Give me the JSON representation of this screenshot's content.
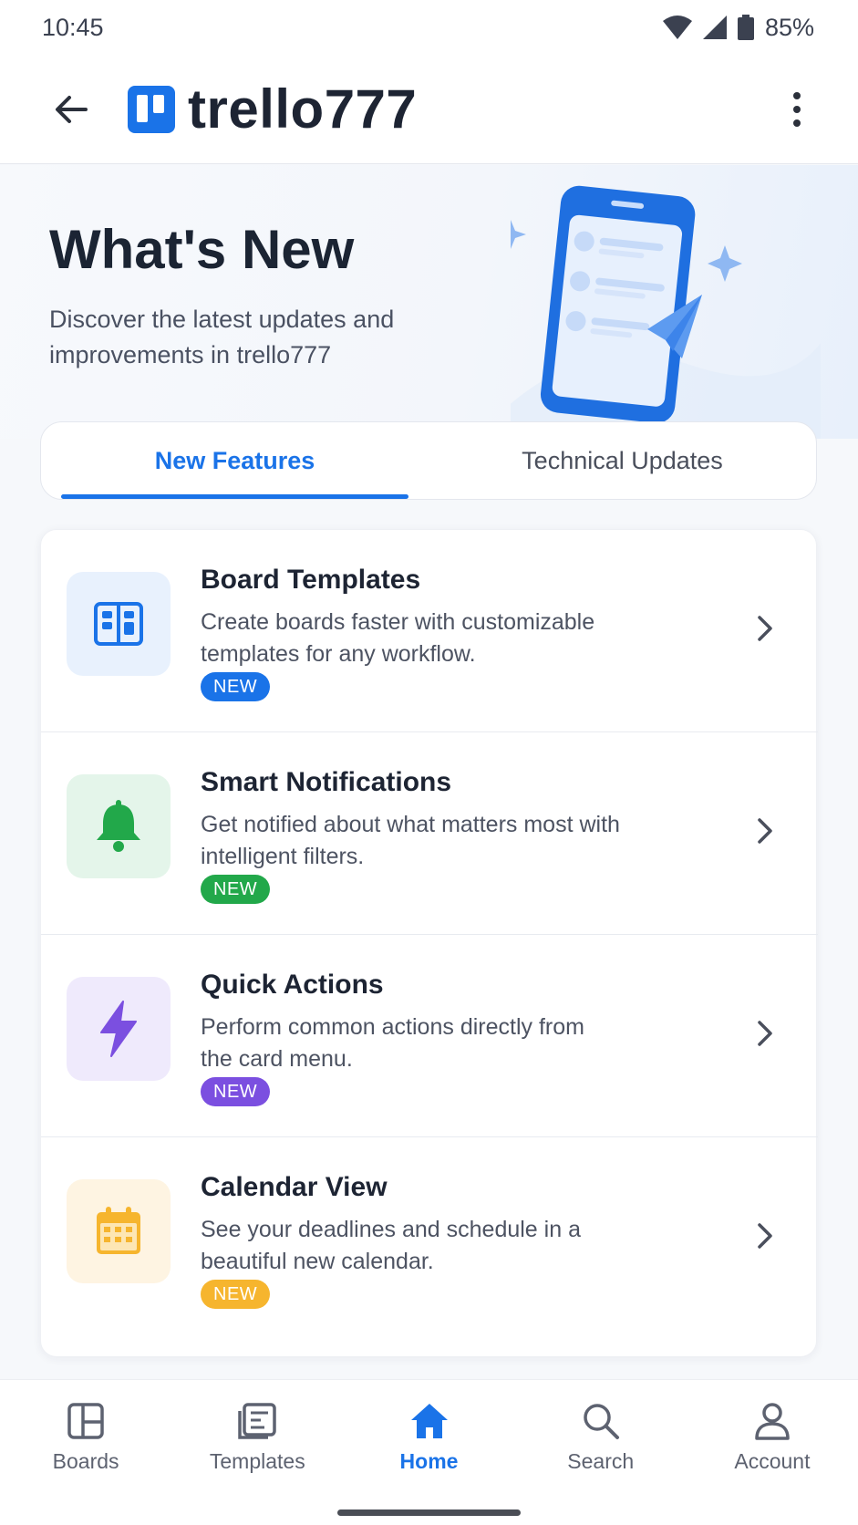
{
  "status_bar": {
    "time": "10:45",
    "battery": "85%"
  },
  "app_bar": {
    "brand": "trello777"
  },
  "hero": {
    "title": "What's New",
    "subtitle": "Discover the latest updates and improvements in trello777"
  },
  "tabs": [
    {
      "label": "New Features",
      "active": true
    },
    {
      "label": "Technical Updates",
      "active": false
    }
  ],
  "features": [
    {
      "title": "Board Templates",
      "description": "Create boards faster with customizable templates for any workflow.",
      "badge": "NEW",
      "icon": "board-template-icon",
      "color": "#1a73e8",
      "tint": "#e8f1fd"
    },
    {
      "title": "Smart Notifications",
      "description": "Get notified about what matters most with intelligent filters.",
      "badge": "NEW",
      "icon": "bell-icon",
      "color": "#22a84a",
      "tint": "#e4f5ea"
    },
    {
      "title": "Quick Actions",
      "description": "Perform common actions directly from the card menu.",
      "badge": "NEW",
      "icon": "lightning-icon",
      "color": "#7b4fe0",
      "tint": "#efeafc"
    },
    {
      "title": "Calendar View",
      "description": "See your deadlines and schedule in a beautiful new calendar.",
      "badge": "NEW",
      "icon": "calendar-icon",
      "color": "#f6b52e",
      "tint": "#fef4e2"
    }
  ],
  "bottom_nav": [
    {
      "label": "Boards",
      "icon": "boards-icon",
      "active": false
    },
    {
      "label": "Templates",
      "icon": "templates-icon",
      "active": false
    },
    {
      "label": "Home",
      "icon": "home-icon",
      "active": true
    },
    {
      "label": "Search",
      "icon": "search-icon",
      "active": false
    },
    {
      "label": "Account",
      "icon": "account-icon",
      "active": false
    }
  ],
  "colors": {
    "accent": "#1a73e8",
    "text": "#1d2433"
  }
}
